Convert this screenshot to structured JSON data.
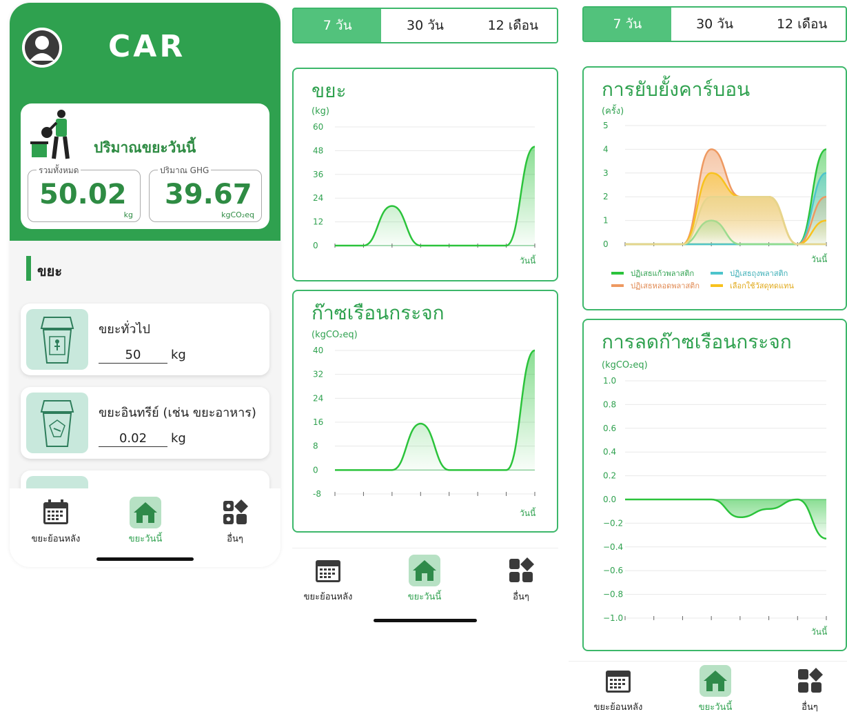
{
  "screen1": {
    "brand": "CAR",
    "summary": {
      "title": "ปริมาณขยะวันนี้",
      "total_label": "รวมทั้งหมด",
      "total_value": "50.02",
      "total_unit": "kg",
      "ghg_label": "ปริมาณ GHG",
      "ghg_value": "39.67",
      "ghg_unit": "kgCO₂eq"
    },
    "section_title": "ขยะ",
    "waste_items": [
      {
        "name": "ขยะทั่วไป",
        "amount": "50",
        "unit": "kg",
        "icon": "general-waste-bin-icon"
      },
      {
        "name": "ขยะอินทรีย์ (เช่น ขยะอาหาร)",
        "amount": "0.02",
        "unit": "kg",
        "icon": "organic-waste-bin-icon"
      }
    ]
  },
  "nav": {
    "history": "ขยะย้อนหลัง",
    "today": "ขยะวันนี้",
    "more": "อื่นๆ"
  },
  "tabs": [
    "7 วัน",
    "30 วัน",
    "12 เดือน"
  ],
  "colors": {
    "accent": "#2fa14f",
    "tab_active": "#52c27c",
    "line_green": "#2bc33b",
    "orange": "#ee9961",
    "teal": "#4dc4cc",
    "yellow": "#f8c21e",
    "light_green": "#8fdc8f"
  },
  "chart_data": [
    {
      "type": "area",
      "title": "ขยะ",
      "ylabel": "(kg)",
      "xlabel": "วันนี้",
      "ylim": [
        0,
        60
      ],
      "yticks": [
        "60",
        "48",
        "36",
        "24",
        "12",
        "0"
      ],
      "series": [
        {
          "values": [
            0,
            0,
            20,
            0,
            0,
            0,
            0,
            50
          ]
        }
      ]
    },
    {
      "type": "area",
      "title": "ก๊าซเรือนกระจก",
      "ylabel": "(kgCO₂eq)",
      "xlabel": "วันนี้",
      "ylim": [
        -8,
        40
      ],
      "yticks": [
        "40",
        "32",
        "24",
        "16",
        "8",
        "0",
        "-8"
      ],
      "series": [
        {
          "values": [
            0,
            0,
            0,
            15.5,
            0,
            0,
            0,
            40
          ]
        }
      ]
    },
    {
      "type": "area",
      "title": "การยับยั้งคาร์บอน",
      "ylabel": "(ครั้ง)",
      "xlabel": "วันนี้",
      "ylim": [
        0,
        5
      ],
      "yticks": [
        "5",
        "4",
        "3",
        "2",
        "1",
        "0"
      ],
      "series": [
        {
          "name": "ปฏิเสธแก้วพลาสติก",
          "color": "#2bc33b",
          "values": [
            0,
            0,
            0,
            0,
            0,
            0,
            0,
            4
          ]
        },
        {
          "name": "ปฏิเสธถุงพลาสติก",
          "color": "#4dc4cc",
          "values": [
            0,
            0,
            0,
            0,
            0,
            0,
            0,
            3
          ]
        },
        {
          "name": "ปฏิเสธหลอดพลาสติก",
          "color": "#ee9961",
          "values": [
            0,
            0,
            0,
            4,
            2,
            2,
            0,
            2
          ]
        },
        {
          "name": "เลือกใช้วัสดุทดแทน",
          "color": "#f8c21e",
          "values": [
            0,
            0,
            0,
            3,
            2,
            2,
            0,
            1
          ]
        },
        {
          "color": "#8fdc8f",
          "values": [
            0,
            0,
            0,
            1,
            0,
            0,
            0,
            0
          ]
        },
        {
          "color": "#e6d58d",
          "values": [
            0,
            0,
            0,
            2,
            2,
            2,
            0,
            0
          ]
        }
      ]
    },
    {
      "type": "area",
      "title": "การลดก๊าซเรือนกระจก",
      "ylabel": "(kgCO₂eq)",
      "xlabel": "วันนี้",
      "ylim": [
        -1.0,
        1.0
      ],
      "yticks": [
        "1.0",
        "0.8",
        "0.6",
        "0.4",
        "0.2",
        "0.0",
        "−0.2",
        "−0.4",
        "−0.6",
        "−0.8",
        "−1.0"
      ],
      "series": [
        {
          "values": [
            0,
            0,
            0,
            0,
            -0.15,
            -0.08,
            0,
            -0.33
          ]
        }
      ]
    }
  ]
}
